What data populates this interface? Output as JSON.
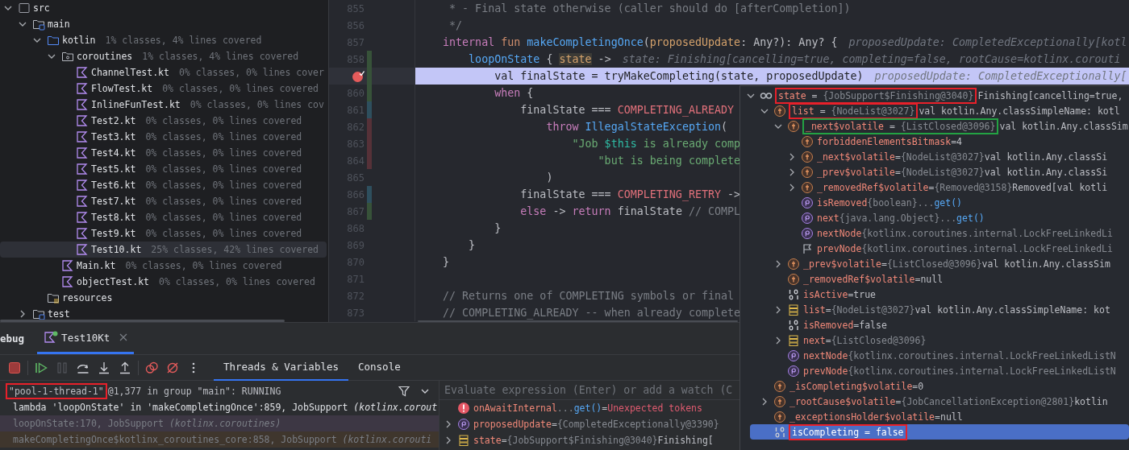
{
  "project_tree": {
    "items": [
      {
        "name": "src",
        "kind": "root-folder",
        "expanded": true,
        "selected": false,
        "children": [
          {
            "name": "main",
            "kind": "module-folder",
            "expanded": true,
            "selected": false,
            "children": [
              {
                "name": "kotlin",
                "kind": "source-folder",
                "coverage": "1% classes, 4% lines covered",
                "expanded": true,
                "selected": false,
                "children": [
                  {
                    "name": "coroutines",
                    "kind": "package",
                    "coverage": "1% classes, 4% lines covered",
                    "expanded": true,
                    "selected": false,
                    "children": [
                      {
                        "name": "ChannelTest.kt",
                        "kind": "kotlin-file",
                        "coverage": "0% classes, 0% lines cover",
                        "selected": false
                      },
                      {
                        "name": "FlowTest.kt",
                        "kind": "kotlin-file",
                        "coverage": "0% classes, 0% lines covered",
                        "selected": false
                      },
                      {
                        "name": "InlineFunTest.kt",
                        "kind": "kotlin-file",
                        "coverage": "0% classes, 0% lines cov",
                        "selected": false
                      },
                      {
                        "name": "Test2.kt",
                        "kind": "kotlin-file",
                        "coverage": "0% classes, 0% lines covered",
                        "selected": false
                      },
                      {
                        "name": "Test3.kt",
                        "kind": "kotlin-file",
                        "coverage": "0% classes, 0% lines covered",
                        "selected": false
                      },
                      {
                        "name": "Test4.kt",
                        "kind": "kotlin-file",
                        "coverage": "0% classes, 0% lines covered",
                        "selected": false
                      },
                      {
                        "name": "Test5.kt",
                        "kind": "kotlin-file",
                        "coverage": "0% classes, 0% lines covered",
                        "selected": false
                      },
                      {
                        "name": "Test6.kt",
                        "kind": "kotlin-file",
                        "coverage": "0% classes, 0% lines covered",
                        "selected": false
                      },
                      {
                        "name": "Test7.kt",
                        "kind": "kotlin-file",
                        "coverage": "0% classes, 0% lines covered",
                        "selected": false
                      },
                      {
                        "name": "Test8.kt",
                        "kind": "kotlin-file",
                        "coverage": "0% classes, 0% lines covered",
                        "selected": false
                      },
                      {
                        "name": "Test9.kt",
                        "kind": "kotlin-file",
                        "coverage": "0% classes, 0% lines covered",
                        "selected": false
                      },
                      {
                        "name": "Test10.kt",
                        "kind": "kotlin-file",
                        "coverage": "25% classes, 42% lines covered",
                        "selected": true
                      }
                    ]
                  },
                  {
                    "name": "Main.kt",
                    "kind": "kotlin-file",
                    "coverage": "0% classes, 0% lines covered",
                    "selected": false
                  },
                  {
                    "name": "objectTest.kt",
                    "kind": "kotlin-file",
                    "coverage": "0% classes, 0% lines covered",
                    "selected": false
                  }
                ]
              },
              {
                "name": "resources",
                "kind": "resources-folder",
                "selected": false
              }
            ]
          },
          {
            "name": "test",
            "kind": "module-folder",
            "expanded": false,
            "selected": false
          }
        ]
      }
    ]
  },
  "editor": {
    "lines": [
      {
        "number": "855",
        "breakpoint": false,
        "current": false,
        "tokens": [
          {
            "kind": "comment",
            "text": " * - Final state otherwise (caller should do [afterCompletion])"
          }
        ]
      },
      {
        "number": "856",
        "breakpoint": false,
        "current": false,
        "tokens": [
          {
            "kind": "comment",
            "text": " */"
          }
        ]
      },
      {
        "number": "857",
        "breakpoint": false,
        "current": false,
        "tokens": [
          {
            "kind": "keyword",
            "text": "internal "
          },
          {
            "kind": "keyword2",
            "text": "fun "
          },
          {
            "kind": "function",
            "text": "makeCompletingOnce"
          },
          {
            "kind": "plain",
            "text": "("
          },
          {
            "kind": "param",
            "text": "proposedUpdate"
          },
          {
            "kind": "plain",
            "text": ": Any?): Any? {"
          }
        ],
        "hint": "proposedUpdate: CompletedExceptionally[kotl"
      },
      {
        "number": "858",
        "breakpoint": false,
        "current": false,
        "color": "#375239",
        "tokens": [
          {
            "kind": "function",
            "text": "    loopOnState"
          },
          {
            "kind": "plain",
            "text": " { "
          },
          {
            "kind": "param-usage",
            "text": "state"
          },
          {
            "kind": "plain",
            "text": " ->"
          }
        ],
        "hint": "state: Finishing[cancelling=true, completing=false, rootCause=kotlinx.corouti"
      },
      {
        "breakpoint": true,
        "current": true,
        "color": "#375239",
        "tokens": [
          {
            "kind": "plain",
            "text": "        val finalState = tryMakeCompleting(state, proposedUpdate)"
          }
        ],
        "hint": "proposedUpdate: CompletedExceptionally["
      },
      {
        "number": "860",
        "breakpoint": false,
        "current": false,
        "color": "#375239",
        "tokens": [
          {
            "kind": "keyword",
            "text": "        when"
          },
          {
            "kind": "plain",
            "text": " {"
          }
        ]
      },
      {
        "number": "861",
        "breakpoint": false,
        "current": false,
        "color": "#2e4f5e",
        "tokens": [
          {
            "kind": "plain",
            "text": "            finalState === "
          },
          {
            "kind": "constant",
            "text": "COMPLETING_ALREADY"
          }
        ]
      },
      {
        "number": "862",
        "breakpoint": false,
        "current": false,
        "color": "#563138",
        "tokens": [
          {
            "kind": "keyword",
            "text": "                throw "
          },
          {
            "kind": "function",
            "text": "IllegalStateException"
          },
          {
            "kind": "plain",
            "text": "("
          }
        ]
      },
      {
        "number": "863",
        "breakpoint": false,
        "current": false,
        "color": "#563138",
        "tokens": [
          {
            "kind": "string",
            "text": "                    \"Job "
          },
          {
            "kind": "template",
            "text": "$this"
          },
          {
            "kind": "string",
            "text": " is already comp"
          }
        ]
      },
      {
        "number": "864",
        "breakpoint": false,
        "current": false,
        "color": "#563138",
        "tokens": [
          {
            "kind": "string",
            "text": "                        \"but is being complete"
          }
        ]
      },
      {
        "number": "865",
        "breakpoint": false,
        "current": false,
        "tokens": [
          {
            "kind": "plain",
            "text": "                )"
          }
        ]
      },
      {
        "number": "866",
        "breakpoint": false,
        "current": false,
        "color": "#2e4f5e",
        "tokens": [
          {
            "kind": "plain",
            "text": "            finalState === "
          },
          {
            "kind": "constant",
            "text": "COMPLETING_RETRY"
          },
          {
            "kind": "plain",
            "text": " ->"
          }
        ]
      },
      {
        "number": "867",
        "breakpoint": false,
        "current": false,
        "color": "#375239",
        "tokens": [
          {
            "kind": "keyword",
            "text": "            else"
          },
          {
            "kind": "plain",
            "text": " -> "
          },
          {
            "kind": "keyword",
            "text": "return"
          },
          {
            "kind": "plain",
            "text": " finalState "
          },
          {
            "kind": "comment",
            "text": "// COMPL"
          }
        ]
      },
      {
        "number": "868",
        "breakpoint": false,
        "current": false,
        "tokens": [
          {
            "kind": "plain",
            "text": "        }"
          }
        ]
      },
      {
        "number": "869",
        "breakpoint": false,
        "current": false,
        "tokens": [
          {
            "kind": "plain",
            "text": "    }"
          }
        ]
      },
      {
        "number": "870",
        "breakpoint": false,
        "current": false,
        "tokens": [
          {
            "kind": "plain",
            "text": "}"
          }
        ]
      },
      {
        "number": "871",
        "breakpoint": false,
        "current": false
      },
      {
        "number": "872",
        "breakpoint": false,
        "current": false,
        "tokens": [
          {
            "kind": "comment",
            "text": "// Returns one of COMPLETING symbols or final"
          }
        ]
      },
      {
        "number": "873",
        "breakpoint": false,
        "current": false,
        "tokens": [
          {
            "kind": "comment",
            "text": "// COMPLETING_ALREADY -- when already complete"
          }
        ]
      }
    ]
  },
  "debug_popup": {
    "items": [
      {
        "kind": "watch",
        "expanded": true,
        "selected": false,
        "parts": [
          {
            "kind": "annotation",
            "color": "#e8202a",
            "parts": [
              {
                "kind": "name",
                "text": "state"
              },
              {
                "kind": "op",
                "text": "="
              },
              {
                "kind": "ref",
                "text": "{JobSupport$Finishing@3040}"
              }
            ]
          },
          {
            "kind": "text",
            "text": "Finishing[cancelling=true,"
          }
        ],
        "children": [
          {
            "kind": "field",
            "expanded": true,
            "selected": false,
            "parts": [
              {
                "kind": "annotation",
                "color": "#e8202a",
                "parts": [
                  {
                    "kind": "name",
                    "text": "list"
                  },
                  {
                    "kind": "op",
                    "text": "="
                  },
                  {
                    "kind": "ref",
                    "text": "{NodeList@3027}"
                  }
                ]
              },
              {
                "kind": "text",
                "text": "val kotlin.Any.classSimpleName: kotl"
              }
            ],
            "children": [
              {
                "kind": "field",
                "expanded": true,
                "selected": false,
                "parts": [
                  {
                    "kind": "annotation",
                    "color": "#23a243",
                    "parts": [
                      {
                        "kind": "name",
                        "text": "_next$volatile"
                      },
                      {
                        "kind": "op",
                        "text": "="
                      },
                      {
                        "kind": "ref",
                        "text": "{ListClosed@3096}"
                      }
                    ]
                  },
                  {
                    "kind": "text",
                    "text": "val kotlin.Any.classSim"
                  }
                ],
                "children": [
                  {
                    "kind": "field",
                    "selected": false,
                    "parts": [
                      {
                        "kind": "name",
                        "text": "forbiddenElementsBitmask"
                      },
                      {
                        "kind": "op",
                        "text": "="
                      },
                      {
                        "kind": "literal",
                        "text": "4"
                      }
                    ]
                  },
                  {
                    "kind": "field",
                    "expanded": false,
                    "selected": false,
                    "parts": [
                      {
                        "kind": "name",
                        "text": "_next$volatile"
                      },
                      {
                        "kind": "op",
                        "text": "="
                      },
                      {
                        "kind": "ref",
                        "text": "{NodeList@3027}"
                      },
                      {
                        "kind": "text",
                        "text": "val kotlin.Any.classSi"
                      }
                    ]
                  },
                  {
                    "kind": "field",
                    "expanded": false,
                    "selected": false,
                    "parts": [
                      {
                        "kind": "name",
                        "text": "_prev$volatile"
                      },
                      {
                        "kind": "op",
                        "text": "="
                      },
                      {
                        "kind": "ref",
                        "text": "{NodeList@3027}"
                      },
                      {
                        "kind": "text",
                        "text": "val kotlin.Any.classSi"
                      }
                    ]
                  },
                  {
                    "kind": "field",
                    "expanded": false,
                    "selected": false,
                    "parts": [
                      {
                        "kind": "name",
                        "text": "_removedRef$volatile"
                      },
                      {
                        "kind": "op",
                        "text": "="
                      },
                      {
                        "kind": "ref",
                        "text": "{Removed@3158}"
                      },
                      {
                        "kind": "text",
                        "text": "Removed[val kotli"
                      }
                    ]
                  },
                  {
                    "kind": "property",
                    "selected": false,
                    "parts": [
                      {
                        "kind": "name",
                        "text": "isRemoved"
                      },
                      {
                        "kind": "ref",
                        "text": "{boolean}"
                      },
                      {
                        "kind": "dim",
                        "text": "..."
                      },
                      {
                        "kind": "call",
                        "text": "get()"
                      }
                    ]
                  },
                  {
                    "kind": "property",
                    "selected": false,
                    "parts": [
                      {
                        "kind": "name",
                        "text": "next"
                      },
                      {
                        "kind": "ref",
                        "text": "{java.lang.Object}"
                      },
                      {
                        "kind": "dim",
                        "text": "..."
                      },
                      {
                        "kind": "call",
                        "text": "get()"
                      }
                    ]
                  },
                  {
                    "kind": "property",
                    "selected": false,
                    "parts": [
                      {
                        "kind": "name",
                        "text": "nextNode"
                      },
                      {
                        "kind": "ref",
                        "text": "{kotlinx.coroutines.internal.LockFreeLinkedLi"
                      }
                    ]
                  },
                  {
                    "kind": "flag",
                    "selected": false,
                    "parts": [
                      {
                        "kind": "name",
                        "text": "prevNode"
                      },
                      {
                        "kind": "ref",
                        "text": "{kotlinx.coroutines.internal.LockFreeLinkedLi"
                      }
                    ]
                  }
                ]
              },
              {
                "kind": "field",
                "expanded": false,
                "selected": false,
                "parts": [
                  {
                    "kind": "name",
                    "text": "_prev$volatile"
                  },
                  {
                    "kind": "op",
                    "text": "="
                  },
                  {
                    "kind": "ref",
                    "text": "{ListClosed@3096}"
                  },
                  {
                    "kind": "text",
                    "text": "val kotlin.Any.classSim"
                  }
                ]
              },
              {
                "kind": "field",
                "selected": false,
                "parts": [
                  {
                    "kind": "name",
                    "text": "_removedRef$volatile"
                  },
                  {
                    "kind": "op",
                    "text": "="
                  },
                  {
                    "kind": "literal",
                    "text": "null"
                  }
                ]
              },
              {
                "kind": "boolean",
                "selected": false,
                "parts": [
                  {
                    "kind": "name",
                    "text": "isActive"
                  },
                  {
                    "kind": "op",
                    "text": "="
                  },
                  {
                    "kind": "literal",
                    "text": "true"
                  }
                ]
              },
              {
                "kind": "collection",
                "expanded": false,
                "selected": false,
                "parts": [
                  {
                    "kind": "name",
                    "text": "list"
                  },
                  {
                    "kind": "op",
                    "text": "="
                  },
                  {
                    "kind": "ref",
                    "text": "{NodeList@3027}"
                  },
                  {
                    "kind": "text",
                    "text": "val kotlin.Any.classSimpleName: kot"
                  }
                ]
              },
              {
                "kind": "boolean",
                "selected": false,
                "parts": [
                  {
                    "kind": "name",
                    "text": "isRemoved"
                  },
                  {
                    "kind": "op",
                    "text": "="
                  },
                  {
                    "kind": "literal",
                    "text": "false"
                  }
                ]
              },
              {
                "kind": "collection",
                "expanded": false,
                "selected": false,
                "parts": [
                  {
                    "kind": "name",
                    "text": "next"
                  },
                  {
                    "kind": "op",
                    "text": "="
                  },
                  {
                    "kind": "ref",
                    "text": "{ListClosed@3096}"
                  }
                ]
              },
              {
                "kind": "property",
                "selected": false,
                "parts": [
                  {
                    "kind": "name",
                    "text": "nextNode"
                  },
                  {
                    "kind": "ref",
                    "text": "{kotlinx.coroutines.internal.LockFreeLinkedListN"
                  }
                ]
              },
              {
                "kind": "property",
                "selected": false,
                "parts": [
                  {
                    "kind": "name",
                    "text": "prevNode"
                  },
                  {
                    "kind": "ref",
                    "text": "{kotlinx.coroutines.internal.LockFreeLinkedListN"
                  }
                ]
              }
            ]
          },
          {
            "kind": "field",
            "selected": false,
            "parts": [
              {
                "kind": "name",
                "text": "_isCompleting$volatile"
              },
              {
                "kind": "op",
                "text": "="
              },
              {
                "kind": "literal",
                "text": "0"
              }
            ]
          },
          {
            "kind": "field",
            "expanded": false,
            "selected": false,
            "parts": [
              {
                "kind": "name",
                "text": "_rootCause$volatile"
              },
              {
                "kind": "op",
                "text": "="
              },
              {
                "kind": "ref",
                "text": "{JobCancellationException@2801}"
              },
              {
                "kind": "text",
                "text": "kotlin"
              }
            ]
          },
          {
            "kind": "field",
            "selected": false,
            "parts": [
              {
                "kind": "name",
                "text": "_exceptionsHolder$volatile"
              },
              {
                "kind": "op",
                "text": "="
              },
              {
                "kind": "literal",
                "text": "null"
              }
            ]
          },
          {
            "kind": "boolean",
            "selected": true,
            "parts": [
              {
                "kind": "annotation",
                "color": "#e8202a",
                "parts": [
                  {
                    "kind": "name",
                    "text": "isCompleting"
                  },
                  {
                    "kind": "op",
                    "text": "="
                  },
                  {
                    "kind": "literal",
                    "text": "false"
                  }
                ]
              }
            ]
          }
        ]
      }
    ]
  },
  "debug_panel": {
    "title": "ebug",
    "tabs": [
      {
        "label": "Test10Kt",
        "selected": true,
        "running": true
      }
    ],
    "toolbar": [
      [
        {
          "kind": "stop",
          "disabled": false
        }
      ],
      [
        {
          "kind": "resume",
          "disabled": false
        },
        {
          "kind": "pause",
          "disabled": true
        },
        {
          "kind": "step-over",
          "disabled": false
        },
        {
          "kind": "step-into",
          "disabled": false
        },
        {
          "kind": "step-out",
          "disabled": false
        }
      ],
      [
        {
          "kind": "view-breakpoints",
          "disabled": false
        },
        {
          "kind": "mute-breakpoints",
          "disabled": false
        },
        {
          "kind": "more",
          "disabled": false
        }
      ]
    ],
    "view_tabs": [
      {
        "label": "Threads & Variables",
        "selected": true
      },
      {
        "label": "Console",
        "selected": false
      }
    ],
    "thread": {
      "parts": [
        {
          "kind": "annotation",
          "color": "#e8202a",
          "parts": [
            {
              "kind": "text",
              "text": "\"pool-1-thread-1\""
            }
          ]
        },
        {
          "kind": "text",
          "text": "@1,377 in group \"main\": RUNNING"
        }
      ]
    },
    "frames": [
      {
        "kind": "current",
        "text": "lambda 'loopOnState' in 'makeCompletingOnce':859, JobSupport *(kotlinx.corout*"
      },
      {
        "kind": "library",
        "text": "loopOnState:170, JobSupport *(kotlinx.coroutines)*"
      },
      {
        "kind": "async",
        "text": "makeCompletingOnce$kotlinx_coroutines_core:858, JobSupport *(kotlinx.corouti*"
      }
    ],
    "evaluate": {
      "placeholder": "Evaluate expression (Enter) or add a watch (C"
    },
    "variables": [
      {
        "kind": "error",
        "selected": false,
        "parts": [
          {
            "kind": "name",
            "text": "onAwaitInternal"
          },
          {
            "kind": "dim",
            "text": "..."
          },
          {
            "kind": "call",
            "text": "get()"
          },
          {
            "kind": "op",
            "text": "="
          },
          {
            "kind": "error",
            "text": "Unexpected tokens"
          }
        ]
      },
      {
        "kind": "property",
        "expanded": false,
        "selected": false,
        "parts": [
          {
            "kind": "name",
            "text": "proposedUpdate"
          },
          {
            "kind": "op",
            "text": "="
          },
          {
            "kind": "ref",
            "text": "{CompletedExceptionally@3390}"
          }
        ]
      },
      {
        "kind": "collection",
        "expanded": false,
        "selected": false,
        "parts": [
          {
            "kind": "name",
            "text": "state"
          },
          {
            "kind": "op",
            "text": "="
          },
          {
            "kind": "ref",
            "text": "{JobSupport$Finishing@3040}"
          },
          {
            "kind": "text",
            "text": "Finishing["
          }
        ]
      }
    ]
  }
}
